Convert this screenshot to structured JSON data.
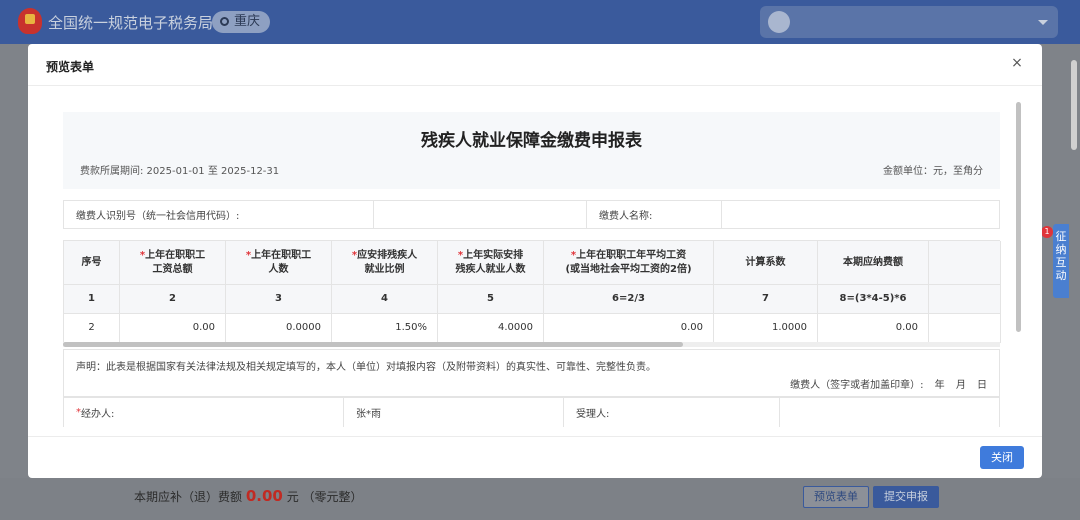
{
  "app": {
    "title": "全国统一规范电子税务局",
    "region": "重庆"
  },
  "footer": {
    "label_prefix": "本期应补（退）费额",
    "amount": "0.00",
    "label_suffix": "元 （零元整）",
    "preview_btn": "预览表单",
    "submit_btn": "提交申报"
  },
  "side_tab": {
    "badge": "1",
    "text": "征纳互动"
  },
  "modal": {
    "title": "预览表单",
    "close_icon": "×",
    "close_btn": "关闭"
  },
  "form": {
    "title": "残疾人就业保障金缴费申报表",
    "period": "费款所属期间:   2025-01-01 至 2025-12-31",
    "unit": "金额单位：元，至角分",
    "payer_id_label": "缴费人识别号（统一社会信用代码）:",
    "payer_id_value": "",
    "payer_name_label": "缴费人名称:",
    "payer_name_value": "",
    "columns": [
      {
        "lines": [
          "序号"
        ],
        "required": false
      },
      {
        "lines": [
          "上年在职职工",
          "工资总额"
        ],
        "required": true
      },
      {
        "lines": [
          "上年在职职工",
          "人数"
        ],
        "required": true
      },
      {
        "lines": [
          "应安排残疾人",
          "就业比例"
        ],
        "required": true
      },
      {
        "lines": [
          "上年实际安排",
          "残疾人就业人数"
        ],
        "required": true
      },
      {
        "lines": [
          "上年在职职工年平均工资",
          "(或当地社会平均工资的2倍)"
        ],
        "required": true
      },
      {
        "lines": [
          "计算系数"
        ],
        "required": false
      },
      {
        "lines": [
          "本期应纳费额"
        ],
        "required": false
      },
      {
        "lines": [
          ""
        ],
        "required": false
      }
    ],
    "formula_row": [
      "1",
      "2",
      "3",
      "4",
      "5",
      "6=2/3",
      "7",
      "8=(3*4-5)*6",
      ""
    ],
    "data_row": [
      "2",
      "0.00",
      "0.0000",
      "1.50%",
      "4.0000",
      "0.00",
      "1.0000",
      "0.00",
      ""
    ],
    "declaration": "声明：此表是根据国家有关法律法规及相关规定填写的，本人（单位）对填报内容（及附带资料）的真实性、可靠性、完整性负责。",
    "signature": "缴费人（签字或者加盖印章）:     年   月   日",
    "handler_label": "经办人:",
    "handler_value": "张*雨",
    "receiver_label": "受理人:"
  }
}
